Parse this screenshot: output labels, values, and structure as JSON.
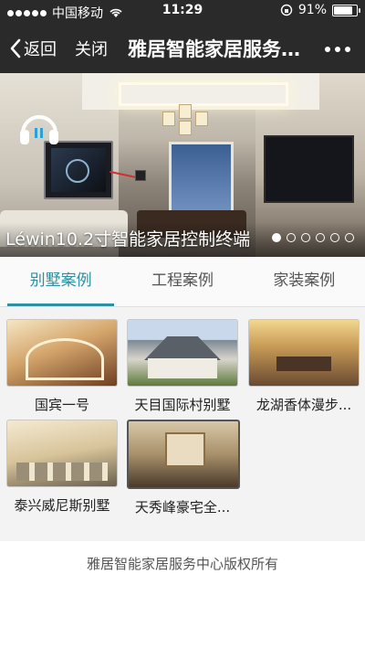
{
  "status_bar": {
    "carrier": "中国移动",
    "time": "11:29",
    "battery": "91%",
    "battery_level": 0.91
  },
  "nav": {
    "back_label": "返回",
    "close_label": "关闭",
    "title": "雅居智能家居服务中心"
  },
  "banner": {
    "caption": "Léwin10.2寸智能家居控制终端",
    "slides_total": 6,
    "active_slide": 1
  },
  "tabs": [
    {
      "label": "别墅案例",
      "active": true
    },
    {
      "label": "工程案例",
      "active": false
    },
    {
      "label": "家装案例",
      "active": false
    }
  ],
  "cases": [
    {
      "title": "国宾一号"
    },
    {
      "title": "天目国际村别墅"
    },
    {
      "title": "龙湖香体漫步..."
    },
    {
      "title": "泰兴威尼斯别墅"
    },
    {
      "title": "天秀峰豪宅全..."
    }
  ],
  "footer": {
    "copyright": "雅居智能家居服务中心版权所有"
  },
  "colors": {
    "accent": "#2f8fa0",
    "nav_background": "#2a2a2a"
  }
}
